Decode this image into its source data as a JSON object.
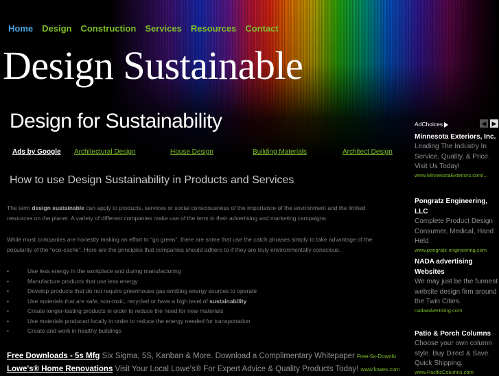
{
  "nav": {
    "items": [
      "Home",
      "Design",
      "Construction",
      "Services",
      "Resources",
      "Contact"
    ]
  },
  "site_title": "Design Sustainable",
  "page_title": "Design for Sustainability",
  "ad_bar": {
    "ads_by": "Ads by Google",
    "links": [
      "Architectural Design",
      "House Design",
      "Building Materials",
      "Architect Design"
    ]
  },
  "article": {
    "heading": "How to use Design Sustainability in Products and Services",
    "p1_pre": "The term ",
    "p1_bold": "design sustainable",
    "p1_post": " can apply to products, services or social consciousness of the importance of the environment and the limited resources on the planet.  A variety of different companies make use of the term in their advertising and marketing campaigns.",
    "p2": "While most companies are honestly making an effort to “go green”, there are some that use the catch phrases simply to take advantage of the popularity of the “eco-cache”.  Here are the principles that companies should adhere to if they are truly environmentally conscious.",
    "bullets": [
      "Use less energy in the workplace and during manufacturing",
      "Manufacture products that use less energy",
      "Develop products that do not require greenhouse gas emitting energy sources to operate",
      "Use materials that are safe, non-toxic, recycled or have a high level of ",
      "Create longer-lasting products in order to reduce the need for new materials",
      "Use materials produced locally in order to reduce the energy needed for transportation",
      "Create and work in healthy buildings"
    ],
    "bullet4_bold": "sustainability"
  },
  "bottom_ads": [
    {
      "title": "Free Downloads - 5s Mfg",
      "body": " Six Sigma, 5S, Kanban & More. Download a Complimentary Whitepaper ",
      "url": "Free-5s-Downlo"
    },
    {
      "title": "Lowe's® Home Renovations",
      "body": " Visit Your Local Lowe's® For Expert Advice & Quality Products Today! ",
      "url": "www.lowes.com"
    }
  ],
  "sidebar": {
    "adchoices": "AdChoices",
    "prev_arrow": "◀",
    "next_arrow": "▶",
    "ads": [
      {
        "title": "Minnesota Exteriors, Inc.",
        "body": "Leading The Industry In Service, Quality, & Price. Visit Us Today!",
        "url": "www.MinnesotaExteriors.com/..."
      },
      {
        "title": "Pongratz Engineering, LLC",
        "body": "Complete Product Design Consumer, Medical, Hand Held",
        "url": "www.pongratz-engineering.com"
      },
      {
        "title": "NADA advertising Websites",
        "body": "We may just be the funnest website design firm around the Twin Cities.",
        "url": "nadaadvertising.com"
      },
      {
        "title": "Patio & Porch Columns",
        "body": "Choose your own column style. Buy Direct & Save. Quick Shipping.",
        "url": "www.PacificColumns.com"
      }
    ]
  },
  "colors": {
    "nav_active": "#4aa3df",
    "nav_link": "#7fbf2a",
    "background": "#000000"
  }
}
